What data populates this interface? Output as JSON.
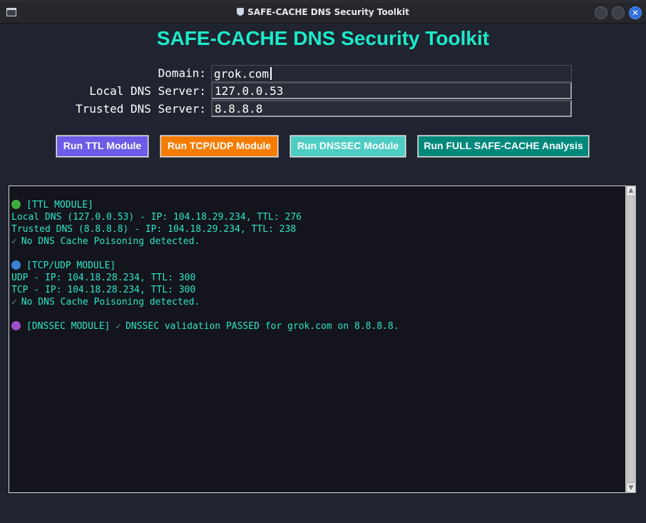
{
  "window": {
    "title": "SAFE-CACHE DNS Security Toolkit",
    "close_glyph": "✕"
  },
  "heading": "SAFE-CACHE DNS Security Toolkit",
  "form": {
    "domain_label": "Domain:",
    "domain_value": "grok.com",
    "local_label": "Local DNS Server:",
    "local_value": "127.0.0.53",
    "trusted_label": "Trusted DNS Server:",
    "trusted_value": "8.8.8.8"
  },
  "buttons": {
    "ttl": {
      "label": "Run TTL Module",
      "color": "#6c5ce7"
    },
    "tcpudp": {
      "label": "Run TCP/UDP Module",
      "color": "#f57c00"
    },
    "dnssec": {
      "label": "Run DNSSEC Module",
      "color": "#4ecdc4"
    },
    "full": {
      "label": "Run FULL SAFE-CACHE Analysis",
      "color": "#00897b"
    }
  },
  "output": {
    "ttl_header": "[TTL MODULE]",
    "ttl_local": "Local DNS (127.0.0.53) - IP: 104.18.29.234, TTL: 276",
    "ttl_trusted": "Trusted DNS (8.8.8.8) - IP: 104.18.29.234, TTL: 238",
    "ttl_result": "No DNS Cache Poisoning detected.",
    "tcp_header": "[TCP/UDP MODULE]",
    "tcp_udp": "UDP - IP: 104.18.28.234, TTL: 300",
    "tcp_tcp": "TCP - IP: 104.18.28.234, TTL: 300",
    "tcp_result": "No DNS Cache Poisoning detected.",
    "dnssec_header": "[DNSSEC MODULE]",
    "dnssec_result": "DNSSEC validation PASSED for grok.com on 8.8.8.8.",
    "check_glyph": "✓",
    "dot_colors": {
      "ttl": "#3fae3f",
      "tcp": "#3b82d6",
      "dnssec": "#9b4fc9"
    }
  },
  "scrollbar": {
    "up_glyph": "▲",
    "down_glyph": "▼"
  },
  "colors": {
    "accent": "#1de9c9",
    "text_output": "#2de6c6",
    "background": "#1f2430"
  }
}
